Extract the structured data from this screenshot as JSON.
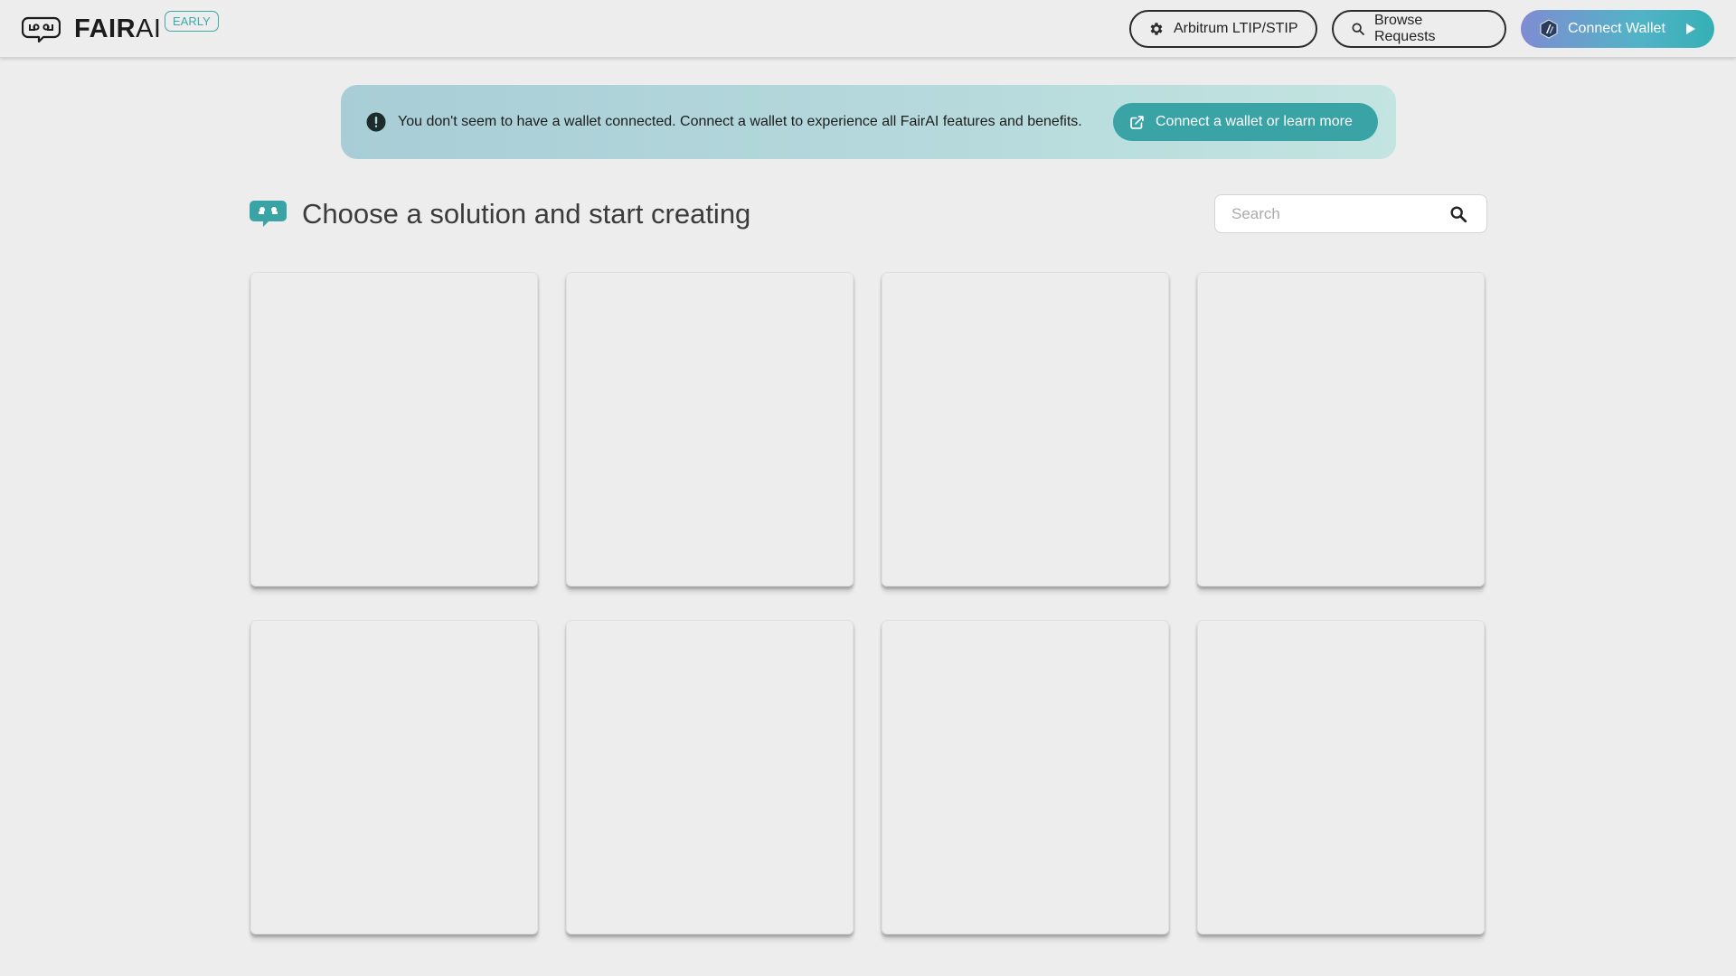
{
  "header": {
    "brand_bold": "FAIR",
    "brand_light": "AI",
    "badge": "EARLY",
    "nav": {
      "arbitrum_label": "Arbitrum LTIP/STIP",
      "browse_label": "Browse Requests",
      "connect_label": "Connect Wallet"
    },
    "icons": [
      "robot-logo-icon",
      "gear-icon",
      "search-icon",
      "arbitrum-logo-icon",
      "play-icon"
    ]
  },
  "notice": {
    "text": "You don't seem to have a wallet connected. Connect a wallet to experience all FairAI features and benefits.",
    "button_label": "Connect a wallet or learn more",
    "icons": [
      "alert-icon",
      "external-link-icon"
    ]
  },
  "main": {
    "title": "Choose a solution and start creating",
    "search": {
      "placeholder": "Search",
      "value": ""
    },
    "cards": [
      {
        "state": "loading"
      },
      {
        "state": "loading"
      },
      {
        "state": "loading"
      },
      {
        "state": "loading"
      },
      {
        "state": "loading"
      },
      {
        "state": "loading"
      },
      {
        "state": "loading"
      },
      {
        "state": "loading"
      }
    ]
  },
  "colors": {
    "background": "#ededed",
    "accent_teal": "#3aa3a6",
    "badge_teal": "#3fa9a8",
    "connect_gradient_start": "#7f8cd2",
    "connect_gradient_end": "#35b0b5",
    "text_dark": "#222222"
  }
}
